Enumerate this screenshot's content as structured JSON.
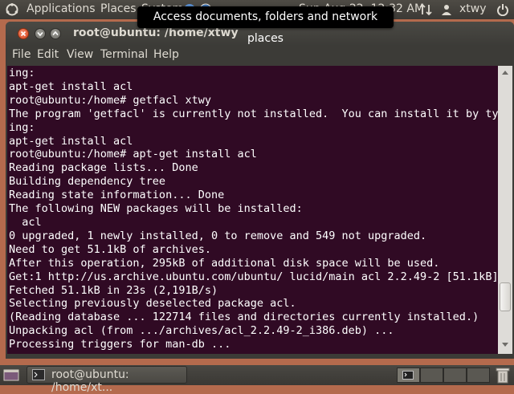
{
  "top_panel": {
    "applications": "Applications",
    "places": "Places",
    "system": "System",
    "clock": "Sun Aug 22, 12:32 AM",
    "user": "xtwy",
    "tooltip": "Access documents, folders and network places"
  },
  "window": {
    "title": "root@ubuntu: /home/xtwy",
    "menu": [
      "File",
      "Edit",
      "View",
      "Terminal",
      "Help"
    ]
  },
  "terminal": {
    "lines": [
      "ing:",
      "apt-get install acl",
      "root@ubuntu:/home# getfacl xtwy",
      "The program 'getfacl' is currently not installed.  You can install it by typ",
      "ing:",
      "apt-get install acl",
      "root@ubuntu:/home# apt-get install acl",
      "Reading package lists... Done",
      "Building dependency tree",
      "Reading state information... Done",
      "The following NEW packages will be installed:",
      "  acl",
      "0 upgraded, 1 newly installed, 0 to remove and 549 not upgraded.",
      "Need to get 51.1kB of archives.",
      "After this operation, 295kB of additional disk space will be used.",
      "Get:1 http://us.archive.ubuntu.com/ubuntu/ lucid/main acl 2.2.49-2 [51.1kB]",
      "Fetched 51.1kB in 23s (2,191B/s)",
      "Selecting previously deselected package acl.",
      "(Reading database ... 122714 files and directories currently installed.)",
      "Unpacking acl (from .../archives/acl_2.2.49-2_i386.deb) ...",
      "Processing triggers for man-db ..."
    ]
  },
  "bottom_panel": {
    "task_label": "root@ubuntu: /home/xt..."
  },
  "colors": {
    "terminal_bg": "#300a24",
    "terminal_fg": "#ffffff",
    "close_button": "#df4a16",
    "desktop": "#b46a4d"
  },
  "icons": [
    "ubuntu-logo-icon",
    "help-icon",
    "network-icon",
    "session-icon",
    "terminal-icon",
    "trash-icon",
    "show-desktop-icon"
  ]
}
